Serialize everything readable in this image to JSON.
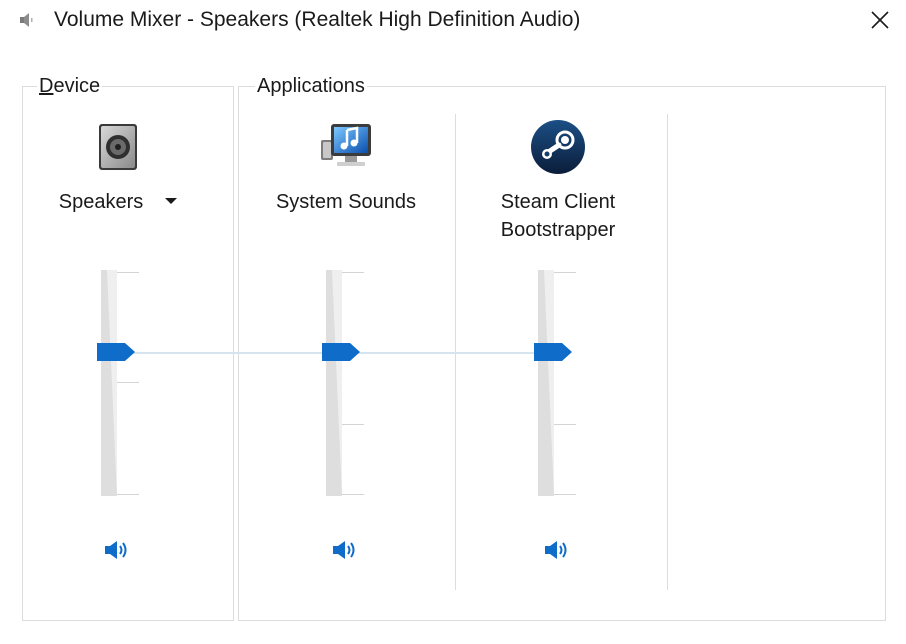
{
  "window": {
    "title": "Volume Mixer - Speakers (Realtek High Definition Audio)",
    "close_icon": "close-icon",
    "title_icon": "speaker-icon"
  },
  "device_group": {
    "legend_accel": "D",
    "legend_rest": "evice",
    "device": {
      "name": "Speakers",
      "icon": "speaker-device-icon",
      "volume": 0.65,
      "mute_icon": "speaker-volume-icon"
    }
  },
  "applications_group": {
    "legend": "Applications",
    "apps": [
      {
        "name": "System Sounds",
        "icon": "system-sounds-icon",
        "volume": 0.65,
        "mute_icon": "speaker-volume-icon"
      },
      {
        "name": "Steam Client Bootstrapper",
        "icon": "steam-icon",
        "volume": 0.65,
        "mute_icon": "speaker-volume-icon"
      }
    ]
  },
  "colors": {
    "accent": "#0f6cc8",
    "border": "#dcdcdc",
    "track": "#dedede"
  }
}
